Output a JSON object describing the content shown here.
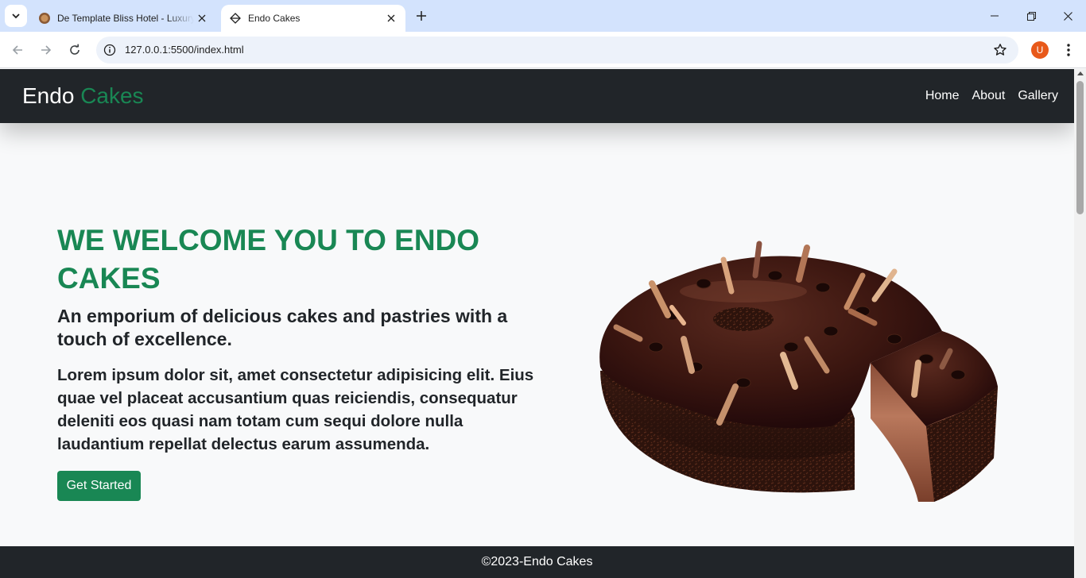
{
  "browser": {
    "tabs": [
      {
        "title": "De Template Bliss Hotel - Luxury",
        "active": false
      },
      {
        "title": "Endo Cakes",
        "active": true
      }
    ],
    "url": "127.0.0.1:5500/index.html",
    "profile_initial": "U"
  },
  "site": {
    "brand": {
      "part1": "Endo",
      "part2": "Cakes"
    },
    "nav": [
      "Home",
      "About",
      "Gallery"
    ],
    "hero": {
      "title": "WE WELCOME YOU TO ENDO CAKES",
      "subtitle": "An emporium of delicious cakes and pastries with a touch of excellence.",
      "body": "Lorem ipsum dolor sit, amet consectetur adipisicing elit. Eius quae vel placeat accusantium quas reiciendis, consequatur deleniti eos quasi nam totam cum sequi dolore nulla laudantium repellat delectus earum assumenda.",
      "cta": "Get Started"
    },
    "footer": "©2023-Endo Cakes"
  },
  "colors": {
    "accent": "#198754",
    "dark": "#212529",
    "background": "#f8f9fa"
  },
  "icons": [
    "tab-search-icon",
    "favicon-icon",
    "close-icon",
    "new-tab-icon",
    "minimize-icon",
    "restore-icon",
    "back-icon",
    "forward-icon",
    "reload-icon",
    "info-icon",
    "star-icon",
    "more-icon"
  ]
}
